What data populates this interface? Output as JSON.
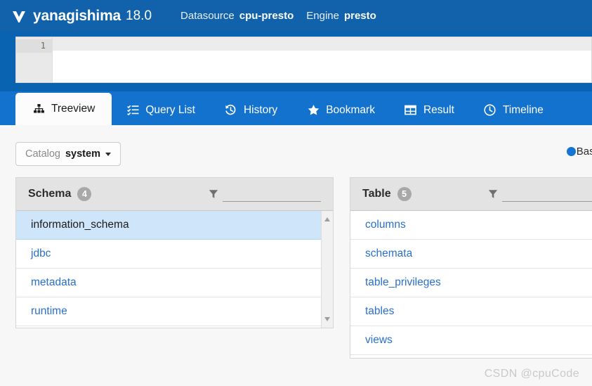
{
  "header": {
    "logo_icon": "yanagishima-logo-icon",
    "brand": "yanagishima",
    "version": "18.0",
    "datasource_label": "Datasource",
    "datasource_value": "cpu-presto",
    "engine_label": "Engine",
    "engine_value": "presto",
    "background_color": "#1262ab"
  },
  "editor": {
    "line_number": "1",
    "code": "",
    "placeholder": ""
  },
  "tabs": [
    {
      "label": "Treeview",
      "icon": "sitemap-icon",
      "active": true
    },
    {
      "label": "Query List",
      "icon": "list-check-icon",
      "active": false
    },
    {
      "label": "History",
      "icon": "history-icon",
      "active": false
    },
    {
      "label": "Bookmark",
      "icon": "star-icon",
      "active": false
    },
    {
      "label": "Result",
      "icon": "table-icon",
      "active": false
    },
    {
      "label": "Timeline",
      "icon": "clock-icon",
      "active": false
    }
  ],
  "toolbar": {
    "catalog_label": "Catalog",
    "catalog_value": "system",
    "caret_icon": "chevron-down-icon",
    "radio_label": "Base",
    "radio_selected": true,
    "radio_color": "#1573d1"
  },
  "schema_panel": {
    "title": "Schema",
    "count": "4",
    "filter_icon": "funnel-icon",
    "filter_value": "",
    "filter_placeholder": "",
    "items": [
      {
        "label": "information_schema",
        "selected": true
      },
      {
        "label": "jdbc",
        "selected": false
      },
      {
        "label": "metadata",
        "selected": false
      },
      {
        "label": "runtime",
        "selected": false
      }
    ],
    "scrollbar": {
      "up_icon": "scroll-up-arrow-icon",
      "down_icon": "scroll-down-arrow-icon"
    }
  },
  "table_panel": {
    "title": "Table",
    "count": "5",
    "filter_icon": "funnel-icon",
    "filter_value": "",
    "filter_placeholder": "",
    "items": [
      {
        "label": "columns",
        "selected": false
      },
      {
        "label": "schemata",
        "selected": false
      },
      {
        "label": "table_privileges",
        "selected": false
      },
      {
        "label": "tables",
        "selected": false
      },
      {
        "label": "views",
        "selected": false
      }
    ]
  },
  "watermark": {
    "text": "CSDN @cpuCode"
  }
}
